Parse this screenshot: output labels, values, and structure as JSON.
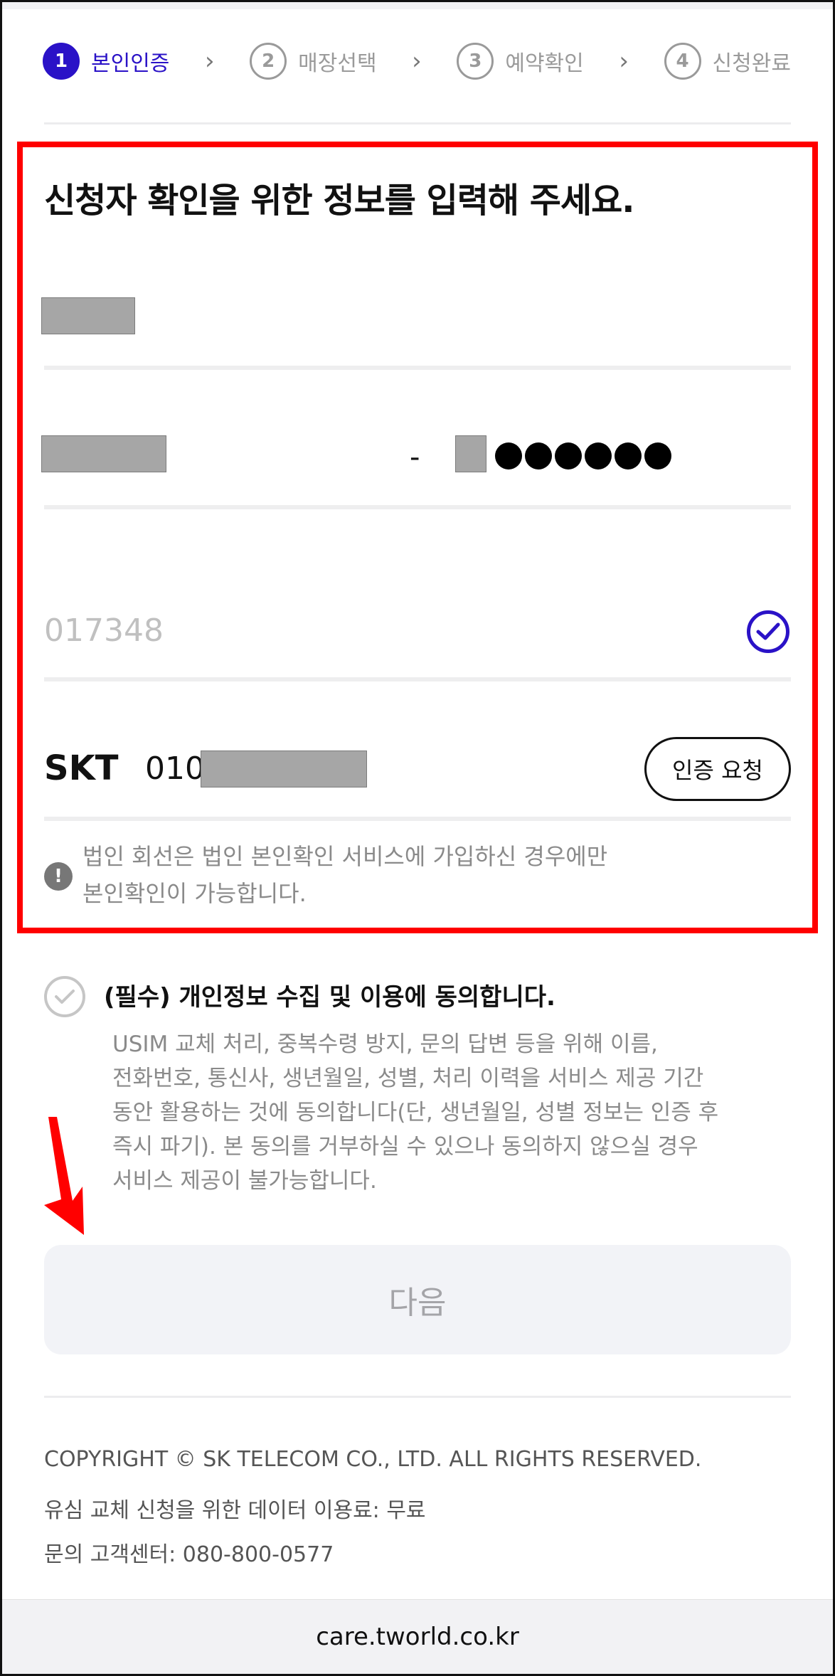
{
  "stepper": {
    "steps": [
      {
        "num": "1",
        "label": "본인인증"
      },
      {
        "num": "2",
        "label": "매장선택"
      },
      {
        "num": "3",
        "label": "예약확인"
      },
      {
        "num": "4",
        "label": "신청완료"
      }
    ],
    "active_step": 1,
    "separator": "›"
  },
  "form": {
    "headline": "신청자 확인을 위한 정보를 입력해 주세요.",
    "id_dash": "-",
    "verification_code_value": "017348",
    "carrier": "SKT",
    "phone_prefix": "010",
    "auth_request_label": "인증 요청",
    "notice_line1": "법인 회선은 법인 본인확인 서비스에 가입하신 경우에만",
    "notice_line2": "본인확인이 가능합니다.",
    "notice_icon": "!"
  },
  "consent": {
    "title": "(필수) 개인정보 수집 및 이용에 동의합니다.",
    "body_lines": [
      "USIM 교체 처리, 중복수령 방지, 문의 답변 등을 위해 이름,",
      "전화번호, 통신사, 생년월일, 성별, 처리 이력을 서비스 제공 기간",
      "동안 활용하는 것에 동의합니다(단, 생년월일, 성별 정보는 인증 후",
      "즉시 파기). 본 동의를 거부하실 수 있으나 동의하지 않으실 경우",
      "서비스 제공이 불가능합니다."
    ]
  },
  "next_button_label": "다음",
  "footer": {
    "copyright": "COPYRIGHT © SK TELECOM CO., LTD. ALL RIGHTS RESERVED.",
    "data_fee": "유심 교체 신청을 위한 데이터 이용료: 무료",
    "contact": "문의 고객센터: 080-800-0577"
  },
  "url_bar": {
    "url": "care.tworld.co.kr"
  },
  "colors": {
    "accent": "#2a12c7",
    "highlight_red": "#ff0000",
    "muted_text": "#8a8a8a"
  },
  "icons": [
    "chevron-right-icon",
    "check-icon",
    "exclamation-icon",
    "red-arrow-icon"
  ]
}
